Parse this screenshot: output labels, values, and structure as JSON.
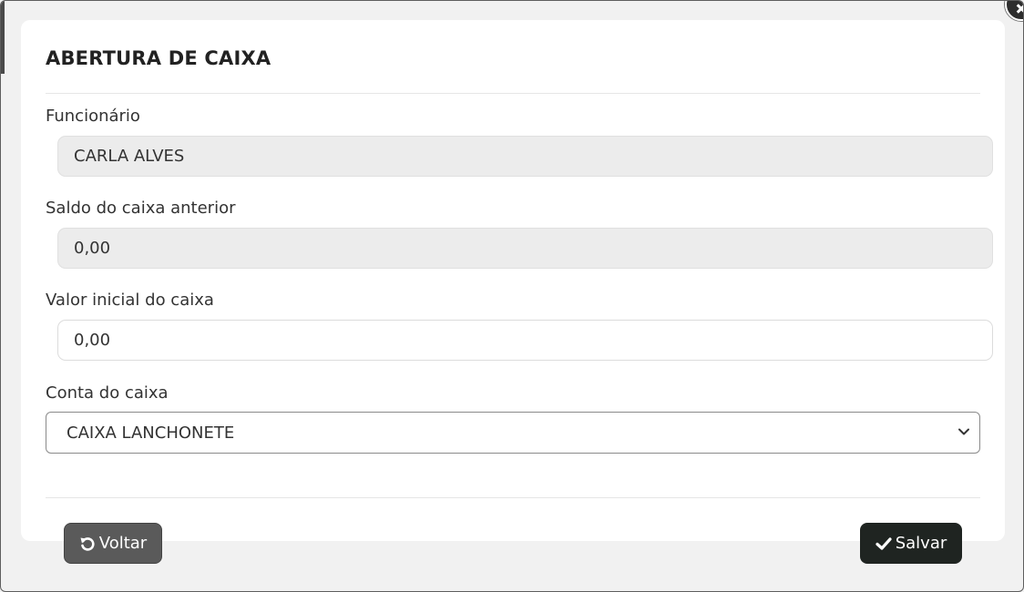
{
  "modal": {
    "title": "ABERTURA DE CAIXA"
  },
  "form": {
    "funcionario": {
      "label": "Funcionário",
      "value": "CARLA ALVES"
    },
    "saldo_anterior": {
      "label": "Saldo do caixa anterior",
      "value": "0,00"
    },
    "valor_inicial": {
      "label": "Valor inicial do caixa",
      "value": "0,00"
    },
    "conta": {
      "label": "Conta do caixa",
      "selected": "CAIXA LANCHONETE"
    }
  },
  "actions": {
    "back_label": "Voltar",
    "save_label": "Salvar"
  },
  "icons": {
    "close": "close-icon",
    "back": "undo-icon",
    "save": "check-icon",
    "dropdown": "chevron-down-icon"
  },
  "colors": {
    "back_button": "#5a5a5a",
    "save_button": "#1f2421",
    "readonly_field": "#ececec"
  }
}
